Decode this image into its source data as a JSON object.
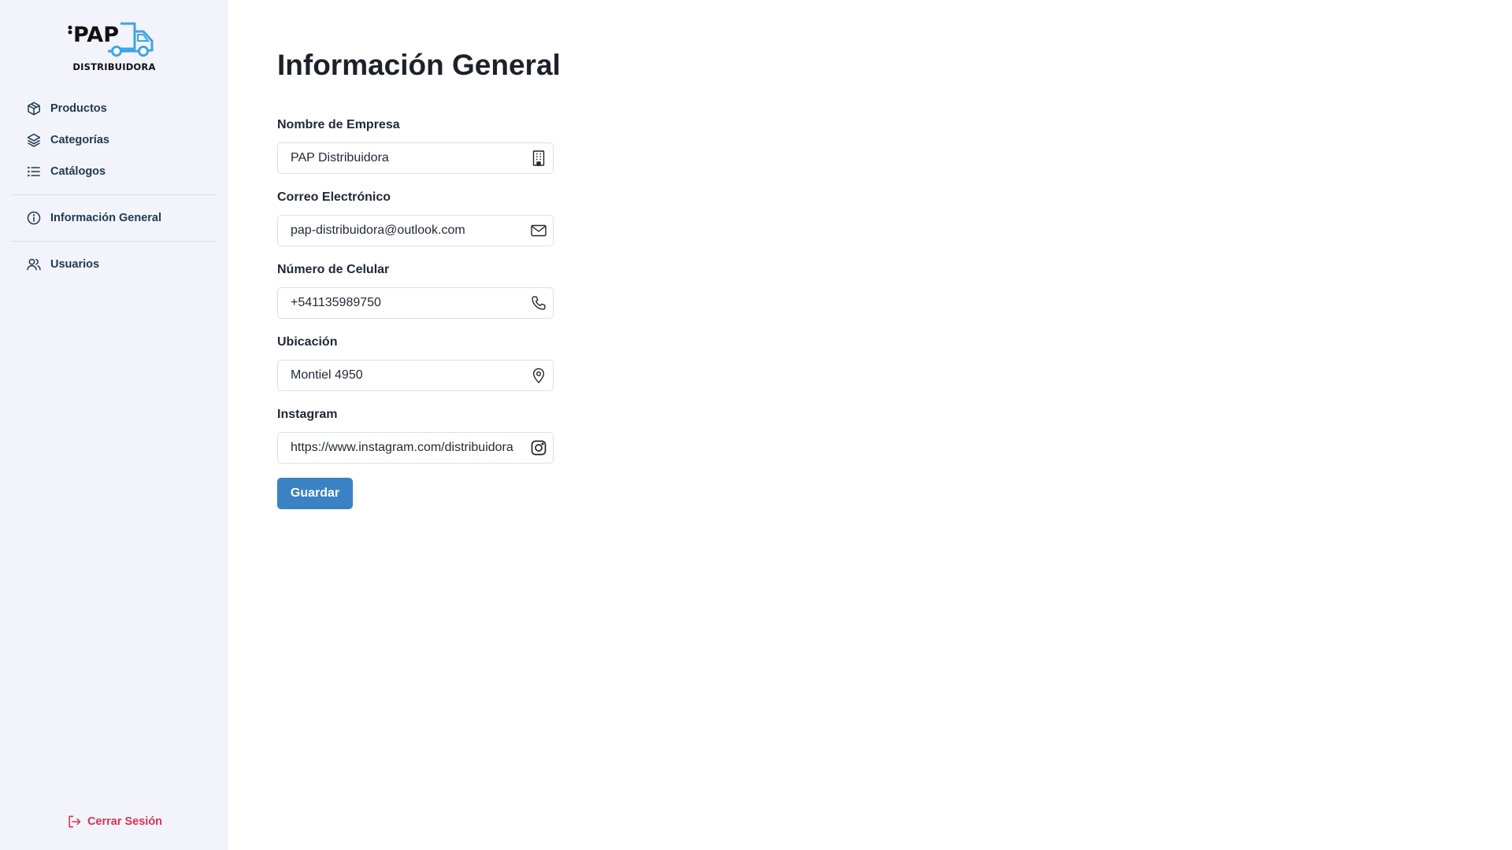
{
  "brand": {
    "logo_text": "PAP",
    "logo_subtitle": "DISTRIBUIDORA",
    "accent_color": "#3ba6e6"
  },
  "sidebar": {
    "items": [
      {
        "label": "Productos",
        "icon": "box-icon"
      },
      {
        "label": "Categorías",
        "icon": "layers-icon"
      },
      {
        "label": "Catálogos",
        "icon": "list-icon"
      },
      {
        "label": "Información General",
        "icon": "info-icon"
      },
      {
        "label": "Usuarios",
        "icon": "users-icon"
      }
    ],
    "logout_label": "Cerrar Sesión",
    "logout_color": "#d9344f",
    "nav_text_color": "#1e3a52"
  },
  "main": {
    "title": "Información General",
    "fields": [
      {
        "label": "Nombre de Empresa",
        "value": "PAP Distribuidora",
        "icon": "building-icon"
      },
      {
        "label": "Correo Electrónico",
        "value": "pap-distribuidora@outlook.com",
        "icon": "envelope-icon"
      },
      {
        "label": "Número de Celular",
        "value": "+541135989750",
        "icon": "phone-icon"
      },
      {
        "label": "Ubicación",
        "value": "Montiel 4950",
        "icon": "map-pin-icon"
      },
      {
        "label": "Instagram",
        "value": "https://www.instagram.com/distribuidora",
        "icon": "instagram-icon"
      }
    ],
    "save_label": "Guardar",
    "button_color": "#3b82c4"
  }
}
